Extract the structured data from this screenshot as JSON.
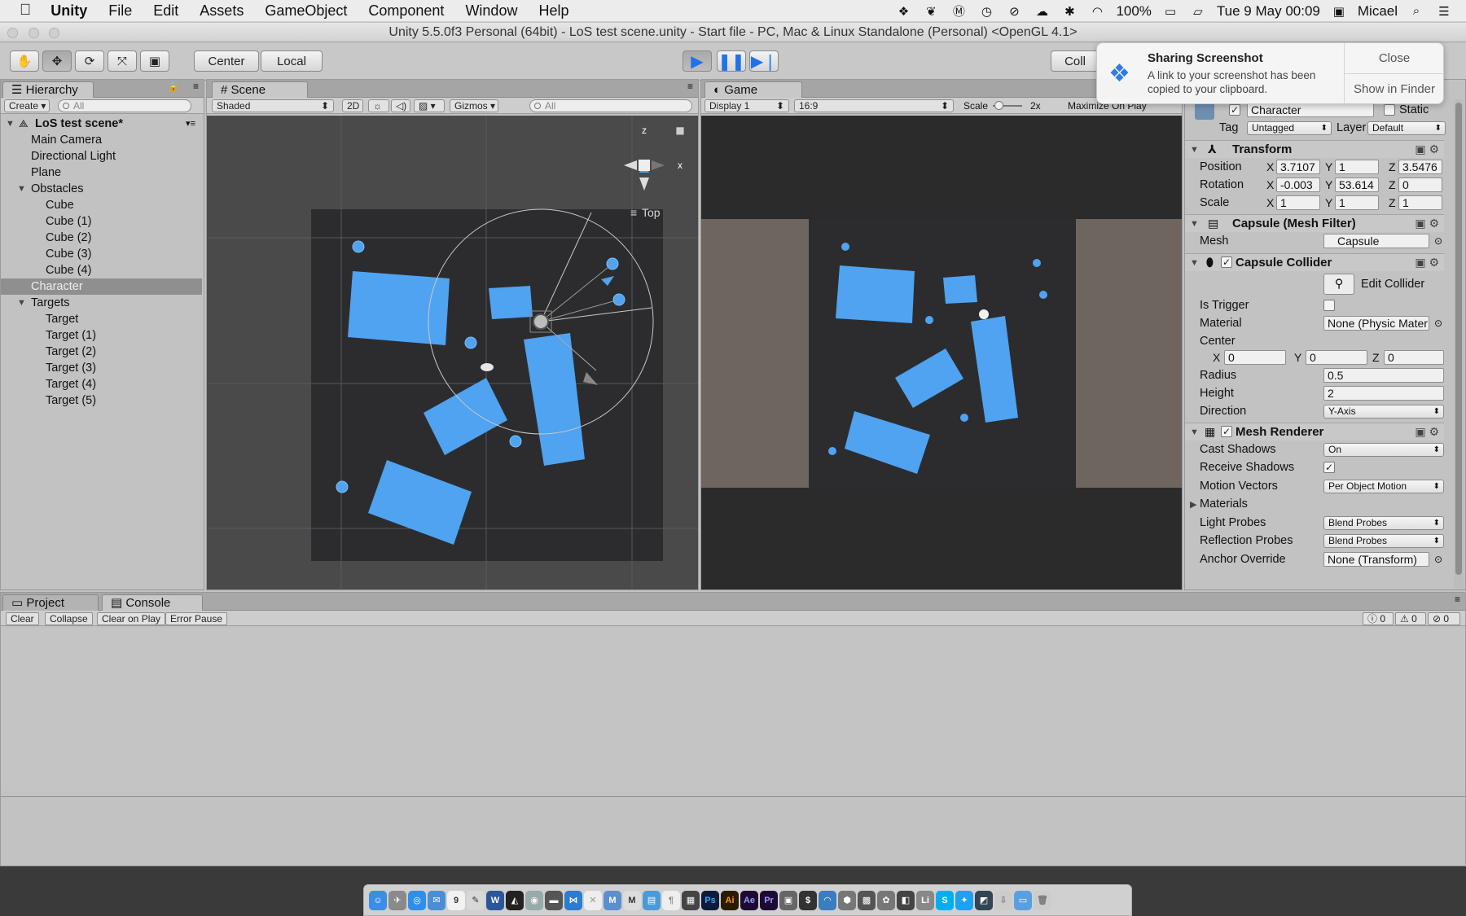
{
  "menubar": {
    "app_name": "Unity",
    "items": [
      "File",
      "Edit",
      "Assets",
      "GameObject",
      "Component",
      "Window",
      "Help"
    ],
    "battery": "100%",
    "datetime": "Tue 9 May  00:09",
    "user": "Micael"
  },
  "window": {
    "title": "Unity 5.5.0f3 Personal (64bit) - LoS test scene.unity - Start file - PC, Mac & Linux Standalone (Personal) <OpenGL 4.1>"
  },
  "toolbar": {
    "pivot_center": "Center",
    "pivot_local": "Local",
    "collab": "Coll"
  },
  "hierarchy": {
    "tab": "Hierarchy",
    "create": "Create",
    "search_placeholder": "All",
    "scene_name": "LoS test scene*",
    "items": [
      {
        "label": "Main Camera",
        "indent": 1
      },
      {
        "label": "Directional Light",
        "indent": 1
      },
      {
        "label": "Plane",
        "indent": 1
      },
      {
        "label": "Obstacles",
        "indent": 1,
        "expanded": true
      },
      {
        "label": "Cube",
        "indent": 2
      },
      {
        "label": "Cube (1)",
        "indent": 2
      },
      {
        "label": "Cube (2)",
        "indent": 2
      },
      {
        "label": "Cube (3)",
        "indent": 2
      },
      {
        "label": "Cube (4)",
        "indent": 2
      },
      {
        "label": "Character",
        "indent": 1,
        "selected": true
      },
      {
        "label": "Targets",
        "indent": 1,
        "expanded": true
      },
      {
        "label": "Target",
        "indent": 2
      },
      {
        "label": "Target (1)",
        "indent": 2
      },
      {
        "label": "Target (2)",
        "indent": 2
      },
      {
        "label": "Target (3)",
        "indent": 2
      },
      {
        "label": "Target (4)",
        "indent": 2
      },
      {
        "label": "Target (5)",
        "indent": 2
      }
    ]
  },
  "scene": {
    "tab": "Scene",
    "shading": "Shaded",
    "mode_2d": "2D",
    "gizmos": "Gizmos",
    "search_placeholder": "All",
    "view_label": "Top",
    "axis_z": "z",
    "axis_x": "x"
  },
  "game": {
    "tab": "Game",
    "display": "Display 1",
    "aspect": "16:9",
    "scale_label": "Scale",
    "scale_value": "2x",
    "maximize": "Maximize On Play"
  },
  "inspector": {
    "object_name": "Character",
    "static_label": "Static",
    "tag_label": "Tag",
    "tag_value": "Untagged",
    "layer_label": "Layer",
    "layer_value": "Default",
    "transform": {
      "title": "Transform",
      "position_label": "Position",
      "rotation_label": "Rotation",
      "scale_label": "Scale",
      "position": [
        "3.7107",
        "1",
        "3.5476"
      ],
      "rotation": [
        "-0.003",
        "53.614",
        "0"
      ],
      "scale": [
        "1",
        "1",
        "1"
      ]
    },
    "mesh_filter": {
      "title": "Capsule (Mesh Filter)",
      "mesh_label": "Mesh",
      "mesh_value": "Capsule"
    },
    "capsule_collider": {
      "title": "Capsule Collider",
      "edit_label": "Edit Collider",
      "is_trigger_label": "Is Trigger",
      "material_label": "Material",
      "material_value": "None (Physic Mater",
      "center_label": "Center",
      "center": [
        "0",
        "0",
        "0"
      ],
      "radius_label": "Radius",
      "radius_value": "0.5",
      "height_label": "Height",
      "height_value": "2",
      "direction_label": "Direction",
      "direction_value": "Y-Axis"
    },
    "mesh_renderer": {
      "title": "Mesh Renderer",
      "cast_shadows_label": "Cast Shadows",
      "cast_shadows_value": "On",
      "receive_shadows_label": "Receive Shadows",
      "motion_vectors_label": "Motion Vectors",
      "motion_vectors_value": "Per Object Motion",
      "materials_label": "Materials",
      "light_probes_label": "Light Probes",
      "light_probes_value": "Blend Probes",
      "reflection_probes_label": "Reflection Probes",
      "reflection_probes_value": "Blend Probes",
      "anchor_override_label": "Anchor Override",
      "anchor_override_value": "None (Transform)"
    }
  },
  "console": {
    "tab_project": "Project",
    "tab_console": "Console",
    "clear": "Clear",
    "collapse": "Collapse",
    "clear_on_play": "Clear on Play",
    "error_pause": "Error Pause",
    "count_info": "0",
    "count_warn": "0",
    "count_error": "0"
  },
  "notification": {
    "title": "Sharing Screenshot",
    "body": "A link to your screenshot has been copied to your clipboard.",
    "close": "Close",
    "show": "Show in Finder"
  },
  "colors": {
    "obstacle": "#4fa3f0",
    "scene_bg": "#4a4a4a",
    "plane": "#2c2c2e",
    "accent_play": "#1e73e8"
  }
}
